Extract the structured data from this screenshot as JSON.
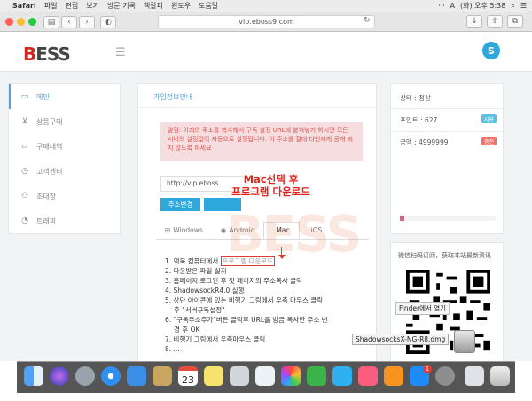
{
  "menubar": {
    "app": "Safari",
    "items": [
      "파일",
      "편집",
      "보기",
      "방문 기록",
      "책갈피",
      "윈도우",
      "도움말"
    ],
    "ime": "A",
    "clock": "(화) 오후 5:38"
  },
  "browser": {
    "url": "vip.eboss9.com",
    "tab_icon_colors": [
      "#fe5f57",
      "#febc2e",
      "#28c840"
    ]
  },
  "site": {
    "logo_prefix": "B",
    "logo_text": "ESS",
    "avatar_letter": "S",
    "sidebar": [
      {
        "label": "메인",
        "icon": "monitor-icon",
        "active": true
      },
      {
        "label": "상품구매",
        "icon": "cart-icon",
        "active": false
      },
      {
        "label": "구매내역",
        "icon": "folder-icon",
        "active": false
      },
      {
        "label": "고객센터",
        "icon": "clock-icon",
        "active": false
      },
      {
        "label": "초대장",
        "icon": "user-icon",
        "active": false
      },
      {
        "label": "트래픽",
        "icon": "chart-icon",
        "active": false
      }
    ],
    "main": {
      "title": "가입정보안내",
      "alert": "알림: 아래의 주소를 복사해서 구독 설정 URL에 붙혀넣기 하시면 모든 서버의 설정값이 자동으로 설정됩니다. 이 주소를 절대 타인에게 공개 되지 않도록 하세요",
      "url_value": "http://vip.eboss",
      "copy_button": "주소변경",
      "tabs": [
        {
          "label": "Windows",
          "icon": "windows-icon",
          "active": false
        },
        {
          "label": "Android",
          "icon": "android-icon",
          "active": false
        },
        {
          "label": "Mac",
          "icon": "apple-icon",
          "active": true
        },
        {
          "label": "iOS",
          "icon": "apple-icon",
          "active": false
        }
      ],
      "steps": [
        {
          "num": "1.",
          "pre": "맥북 컴퓨터에서 ",
          "highlight": "프로그램 다운로드"
        },
        {
          "num": "2.",
          "pre": "다운받은 파일 실지",
          "highlight": ""
        },
        {
          "num": "3.",
          "pre": "홈페이지 로그인 후 첫 페이지의 주소복사 클릭",
          "highlight": ""
        },
        {
          "num": "4.",
          "pre": "ShadowsockR4.0 실행",
          "highlight": ""
        },
        {
          "num": "5.",
          "pre": "상단 아이콘에 있는 비행기 그림에서 우측 마우스 클릭",
          "highlight": ""
        },
        {
          "num": "",
          "pre": "후 \"서버구독설정\"",
          "highlight": ""
        },
        {
          "num": "6.",
          "pre": "\"구독주소추가\"버튼 클릭후 URL을 방금 복사한 주소 변",
          "highlight": ""
        },
        {
          "num": "",
          "pre": "경 후 OK",
          "highlight": ""
        },
        {
          "num": "7.",
          "pre": "비행기 그림에서 우측마우스 클릭",
          "highlight": ""
        },
        {
          "num": "8.",
          "pre": "...",
          "highlight": ""
        }
      ],
      "watermark": "BESS",
      "overlay_line1": "Mac선택 후",
      "overlay_line2": "프로그램 다운로드"
    },
    "right": {
      "status": "상태 : 정상",
      "points": "포인트 : 627",
      "points_badge": "사용",
      "amount": "금액 : 4999999",
      "amount_badge": "충전",
      "progress": 0.05,
      "qr_title": "微信扫码订阅，获取本站最新资讯"
    },
    "finder_tooltip": "Finder에서 열기",
    "download_tooltip": "ShadowsocksX-NG-R8.dmg"
  },
  "dock": {
    "icons": [
      "finder-icon",
      "siri-icon",
      "launchpad-icon",
      "safari-icon",
      "mail-icon",
      "notes-icon",
      "calendar-icon",
      "stickies-icon",
      "preview-icon",
      "photos-icon",
      "facetime-icon",
      "messages-icon",
      "music-icon",
      "books-icon",
      "appstore-icon",
      "settings-icon",
      "downloads-icon",
      "trash-icon"
    ],
    "calendar_day": "23",
    "appstore_badge": "1"
  }
}
